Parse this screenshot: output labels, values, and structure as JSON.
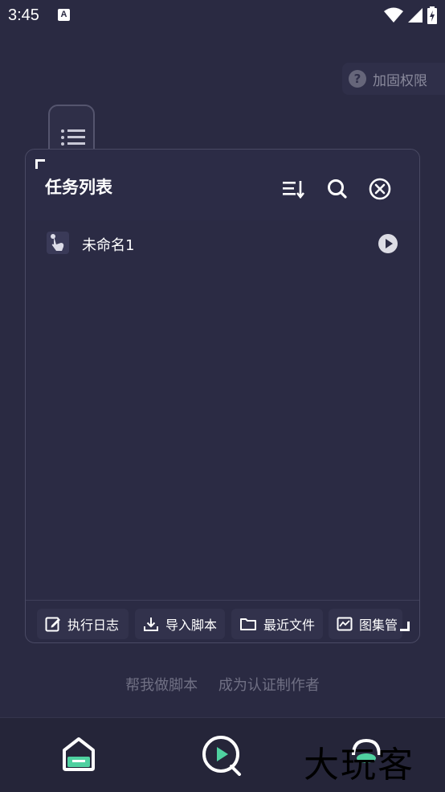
{
  "status": {
    "time": "3:45",
    "notif_letter": "A"
  },
  "background": {
    "permission_label": "加固权限",
    "primary_button": "",
    "secondary_button": "",
    "links": [
      "帮我做脚本",
      "成为认证制作者"
    ]
  },
  "panel": {
    "title": "任务列表",
    "tasks": [
      {
        "name": "未命名1"
      }
    ],
    "footer": [
      {
        "label": "执行日志",
        "icon": "edit-icon"
      },
      {
        "label": "导入脚本",
        "icon": "download-icon"
      },
      {
        "label": "最近文件",
        "icon": "folder-icon"
      },
      {
        "label": "图集管",
        "icon": "chart-icon"
      }
    ]
  },
  "watermark": "大玩客",
  "colors": {
    "accent": "#4fd1a0",
    "background": "#2a2a42",
    "panel": "#2b2b44"
  }
}
